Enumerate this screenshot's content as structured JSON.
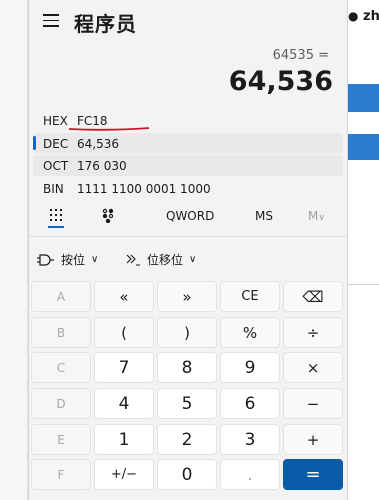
{
  "background": {
    "user_text": "zh"
  },
  "title": "程序员",
  "expression": "64535 =",
  "result": "64,536",
  "radix": [
    {
      "name": "HEX",
      "value": "FC18"
    },
    {
      "name": "DEC",
      "value": "64,536"
    },
    {
      "name": "OCT",
      "value": "176 030"
    },
    {
      "name": "BIN",
      "value": "1111 1100 0001 1000"
    }
  ],
  "active_radix": "DEC",
  "toolbar": {
    "word_size": "QWORD",
    "ms": "MS",
    "m_dropdown": "M"
  },
  "bitops": {
    "bitwise": "按位",
    "bitshift": "位移位"
  },
  "keys": [
    [
      "A",
      "«",
      "»",
      "CE",
      "⌫"
    ],
    [
      "B",
      "(",
      ")",
      "%",
      "÷"
    ],
    [
      "C",
      "7",
      "8",
      "9",
      "×"
    ],
    [
      "D",
      "4",
      "5",
      "6",
      "−"
    ],
    [
      "E",
      "1",
      "2",
      "3",
      "+"
    ],
    [
      "F",
      "+/−",
      "0",
      ".",
      "="
    ]
  ],
  "colors": {
    "accent": "#0b5ca8",
    "underline": "#d0112b"
  }
}
